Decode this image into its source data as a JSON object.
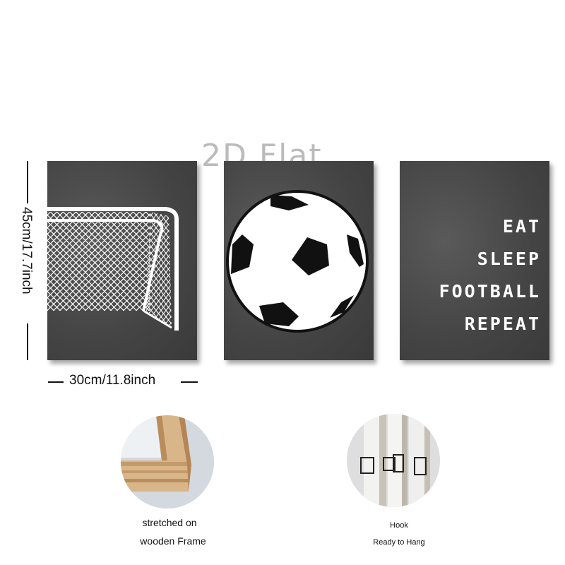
{
  "watermark": "2D Flat",
  "panels": {
    "goal": {
      "icon": "goal-net-icon"
    },
    "ball": {
      "icon": "soccer-ball-icon"
    },
    "slogan": {
      "lines": [
        "EAT",
        "SLEEP",
        "FOOTBALL",
        "REPEAT"
      ]
    }
  },
  "dimensions": {
    "height_label": "45cm/17.7inch",
    "width_label": "30cm/11.8inch"
  },
  "details": [
    {
      "icon": "wooden-frame-icon",
      "caption_lines": [
        "stretched on",
        "wooden Frame"
      ]
    },
    {
      "icon": "hook-icon",
      "caption_lines": [
        "Hook",
        "Ready to Hang"
      ]
    }
  ],
  "colors": {
    "panel_bg": "#4a4a4a",
    "text_white": "#ffffff",
    "wood": "#d9b68a"
  }
}
